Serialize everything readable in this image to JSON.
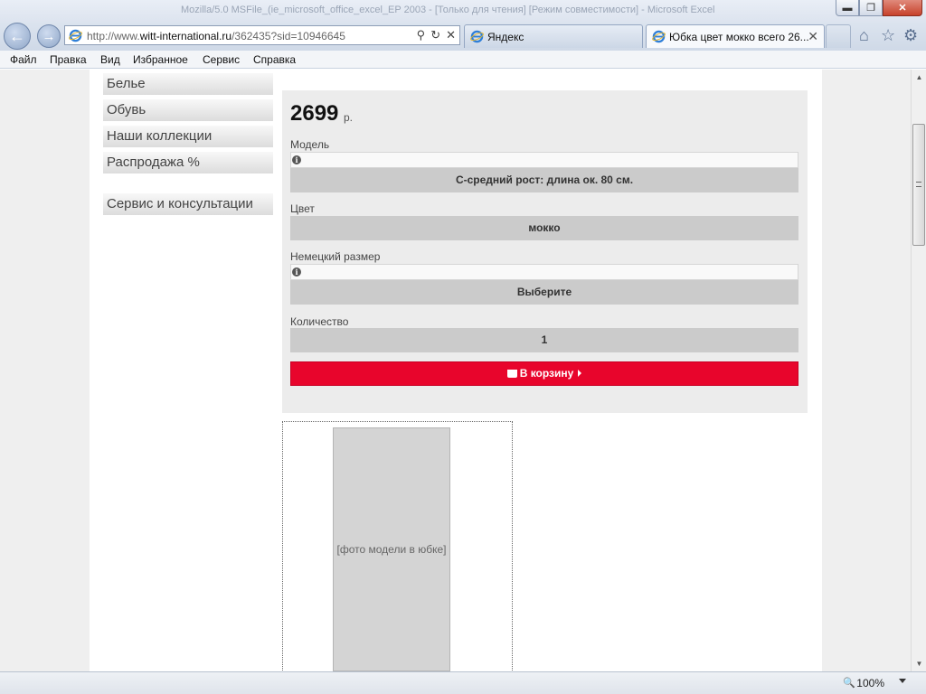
{
  "window": {
    "title": "Mozilla/5.0 MSFile_(ie_microsoft_office_excel_EP 2003 - [Только для чтения] [Режим совместимости] - Microsoft Excel",
    "minimize": "▬",
    "restore": "❐",
    "close": "✕"
  },
  "address_bar": {
    "back": "←",
    "forward": "→",
    "url_prefix": "http://www.",
    "url_domain": "witt-international.ru",
    "url_suffix": "/362435?sid=10946645",
    "search_icon": "⚲",
    "refresh_icon": "↻",
    "stop_icon": "✕"
  },
  "tabs": [
    {
      "label": "Яндекс",
      "active": false
    },
    {
      "label": "Юбка цвет мокко всего 26...",
      "active": true,
      "close": "✕"
    }
  ],
  "toolbar_icons": {
    "home": "⌂",
    "favorites": "☆",
    "tools": "⚙"
  },
  "menu": [
    "Файл",
    "Правка",
    "Вид",
    "Избранное",
    "Сервис",
    "Справка"
  ],
  "sidebar": {
    "items": [
      "Белье",
      "Обувь",
      "Наши коллекции",
      "Распродажа %"
    ],
    "service": "Сервис и консультации"
  },
  "product": {
    "price": "2699",
    "currency": "р.",
    "model_label": "Модель",
    "model_value": "С-средний рост: длина ок. 80 см.",
    "color_label": "Цвет",
    "color_value": "мокко",
    "size_label": "Немецкий размер",
    "size_value": "Выберите",
    "qty_label": "Количество",
    "qty_value": "1",
    "cart_button": "В корзину",
    "info_icon": "i",
    "accent": "#e8052c"
  },
  "photo": {
    "placeholder": "[фото модели в юбке]"
  },
  "scrollbar": {
    "up": "▲",
    "down": "▼"
  },
  "status": {
    "zoom": "100%",
    "zoom_icon": "🔍"
  }
}
